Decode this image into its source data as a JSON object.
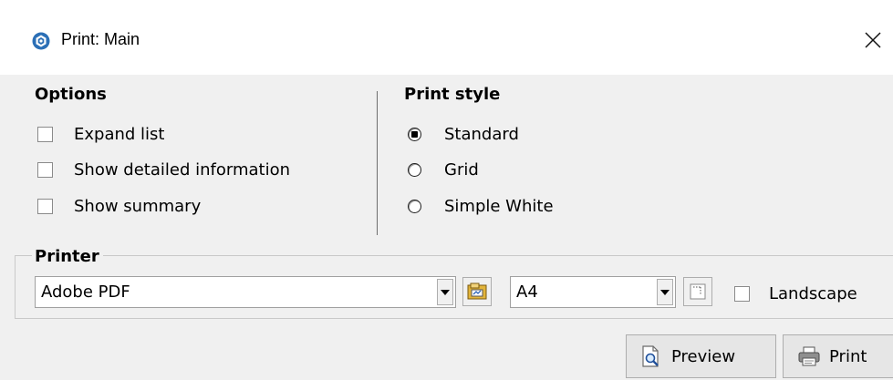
{
  "window": {
    "title": "Print: Main",
    "accent": "#2b6fb6"
  },
  "options": {
    "title": "Options",
    "items": [
      {
        "label": "Expand list",
        "checked": false
      },
      {
        "label": "Show detailed information",
        "checked": false
      },
      {
        "label": "Show summary",
        "checked": false
      }
    ]
  },
  "print_style": {
    "title": "Print style",
    "items": [
      {
        "label": "Standard",
        "selected": true
      },
      {
        "label": "Grid",
        "selected": false
      },
      {
        "label": "Simple White",
        "selected": false
      }
    ]
  },
  "printer": {
    "title": "Printer",
    "printer_value": "Adobe PDF",
    "paper_value": "A4",
    "landscape_label": "Landscape",
    "landscape_checked": false
  },
  "buttons": {
    "preview_label": "Preview",
    "print_label": "Print"
  },
  "icons": {
    "app": "app-hex-icon",
    "close": "close-icon",
    "dropdown": "dropdown-arrow-icon",
    "printer_properties": "printer-properties-icon",
    "page_setup": "page-setup-icon",
    "preview": "magnifier-page-icon",
    "print": "printer-icon"
  }
}
